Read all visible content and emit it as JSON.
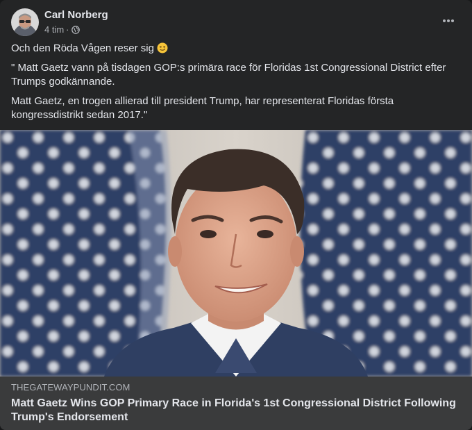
{
  "post": {
    "author": "Carl Norberg",
    "time": "4 tim",
    "separator": "·",
    "privacy_icon": "globe-icon",
    "more_icon": "more-options-icon",
    "text": {
      "line1": "Och den Röda Vågen reser sig",
      "emoji": "smirk-emoji",
      "paragraph2": "\" Matt Gaetz vann på tisdagen GOP:s primära race för Floridas 1st Congressional District efter Trumps godkännande.",
      "paragraph3": "Matt Gaetz, en trogen allierad till president Trump, har representerat Floridas första kongressdistrikt sedan 2017.\""
    },
    "link": {
      "domain": "THEGATEWAYPUNDIT.COM",
      "title": "Matt Gaetz Wins GOP Primary Race in Florida's 1st Congressional District Following Trump's Endorsement"
    }
  },
  "colors": {
    "background": "#242526",
    "link_box": "#3a3b3c",
    "primary_text": "#e4e6eb",
    "secondary_text": "#b0b3b8"
  }
}
